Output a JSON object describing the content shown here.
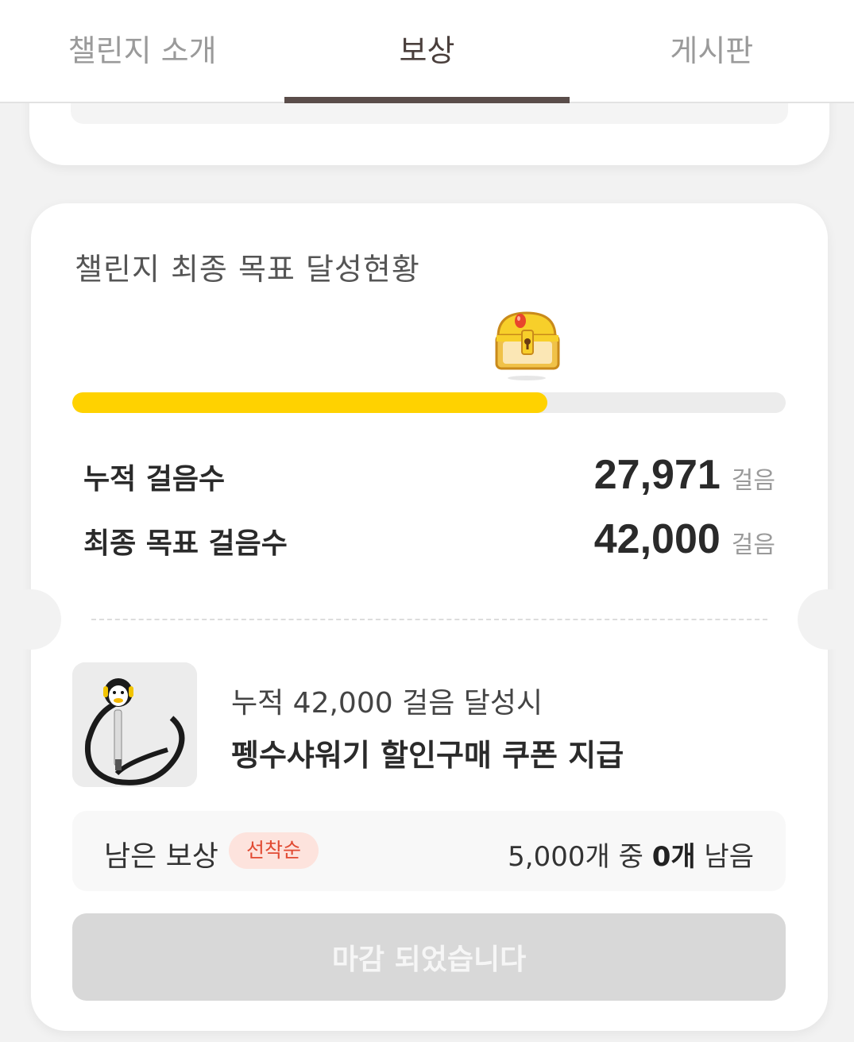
{
  "tabs": [
    {
      "label": "챌린지 소개",
      "active": false
    },
    {
      "label": "보상",
      "active": true
    },
    {
      "label": "게시판",
      "active": false
    }
  ],
  "progress_card": {
    "title": "챌린지 최종 목표 달성현황",
    "progress_fraction": 0.666,
    "accumulated": {
      "label": "누적 걸음수",
      "value": "27,971",
      "unit": "걸음"
    },
    "goal": {
      "label": "최종 목표 걸음수",
      "value": "42,000",
      "unit": "걸음"
    }
  },
  "reward": {
    "condition": "누적 42,000 걸음 달성시",
    "title": "펭수샤워기 할인구매 쿠폰 지급",
    "remaining_label": "남은 보상",
    "badge": "선착순",
    "remaining_prefix": "5,000개 중 ",
    "remaining_count": "0개",
    "remaining_suffix": " 남음",
    "button_label": "마감 되었습니다"
  },
  "colors": {
    "progress": "#ffd200",
    "badge_text": "#e14a32",
    "badge_bg": "#fde3dd",
    "tab_active": "#4a3f3c"
  },
  "icons": {
    "chest": "treasure-chest-icon"
  }
}
